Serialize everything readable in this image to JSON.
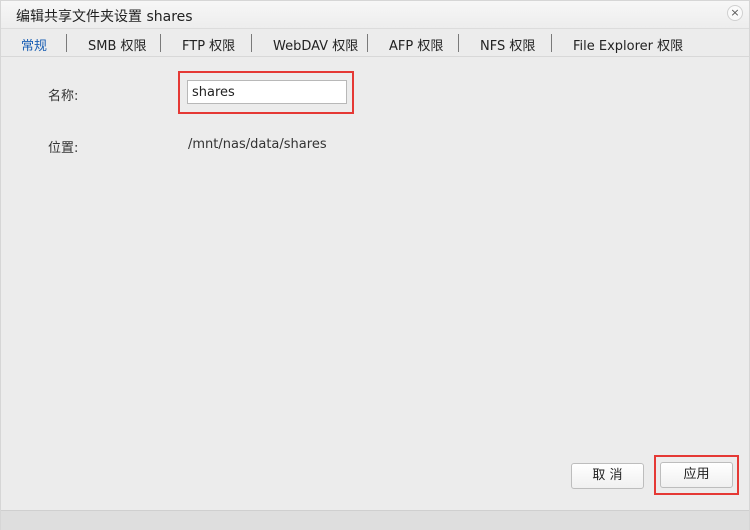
{
  "dialog": {
    "title": "编辑共享文件夹设置 shares",
    "close_icon": "×"
  },
  "tabs": [
    {
      "label": "常规",
      "active": true
    },
    {
      "label": "SMB 权限",
      "active": false
    },
    {
      "label": "FTP 权限",
      "active": false
    },
    {
      "label": "WebDAV 权限",
      "active": false
    },
    {
      "label": "AFP 权限",
      "active": false
    },
    {
      "label": "NFS 权限",
      "active": false
    },
    {
      "label": "File Explorer 权限",
      "active": false
    }
  ],
  "form": {
    "name_label": "名称:",
    "name_value": "shares",
    "location_label": "位置:",
    "location_value": "/mnt/nas/data/shares"
  },
  "buttons": {
    "cancel": "取 消",
    "apply": "应用"
  },
  "colors": {
    "active_tab": "#1a5fb4",
    "highlight": "#e53935"
  }
}
